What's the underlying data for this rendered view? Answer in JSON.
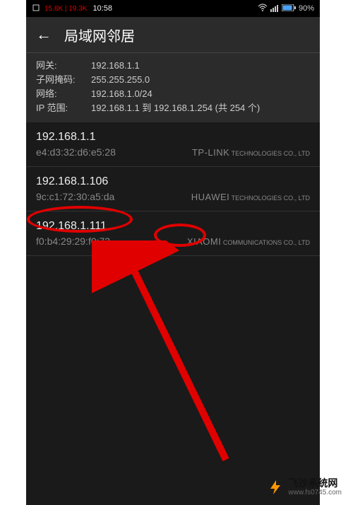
{
  "status": {
    "speed_down": "15.8K",
    "speed_up": "19.3K",
    "time": "10:58",
    "battery": "90%"
  },
  "header": {
    "title": "局域网邻居"
  },
  "info": {
    "gateway_label": "网关:",
    "gateway_value": "192.168.1.1",
    "subnet_label": "子网掩码:",
    "subnet_value": "255.255.255.0",
    "network_label": "网络:",
    "network_value": "192.168.1.0/24",
    "range_label": "IP 范围:",
    "range_value": "192.168.1.1 到 192.168.1.254 (共 254 个)"
  },
  "devices": [
    {
      "ip": "192.168.1.1",
      "mac": "e4:d3:32:d6:e5:28",
      "vendor_main": "TP-LINK",
      "vendor_sub": " TECHNOLOGIES CO., LTD"
    },
    {
      "ip": "192.168.1.106",
      "mac": "9c:c1:72:30:a5:da",
      "vendor_main": "HUAWEI",
      "vendor_sub": " TECHNOLOGIES CO., LTD"
    },
    {
      "ip": "192.168.1.111",
      "mac": "f0:b4:29:29:f0:72",
      "vendor_main": "XIAOMI",
      "vendor_sub": " COMMUNICATIONS CO., LTD"
    }
  ],
  "watermark": {
    "title": "飞沙系统网",
    "url": "www.fs0745.com"
  }
}
